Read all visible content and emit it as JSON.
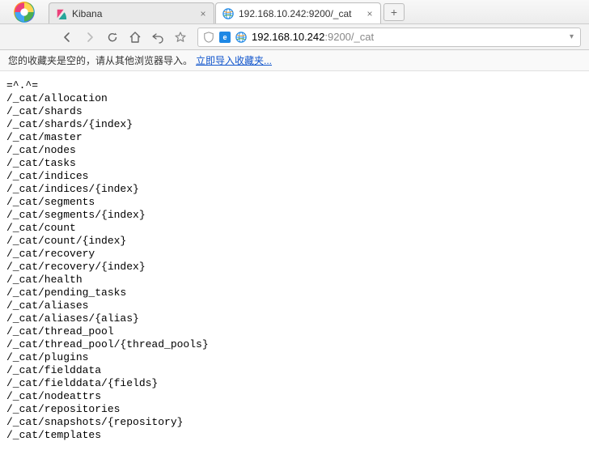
{
  "tabs": [
    {
      "title": "Kibana"
    },
    {
      "title": "192.168.10.242:9200/_cat"
    }
  ],
  "address": {
    "host": "192.168.10.242",
    "port_path": ":9200/_cat"
  },
  "bookmarks_bar": {
    "empty_msg": "您的收藏夹是空的，请从其他浏览器导入。",
    "import_link": "立即导入收藏夹..."
  },
  "body_lines": [
    "=^.^=",
    "/_cat/allocation",
    "/_cat/shards",
    "/_cat/shards/{index}",
    "/_cat/master",
    "/_cat/nodes",
    "/_cat/tasks",
    "/_cat/indices",
    "/_cat/indices/{index}",
    "/_cat/segments",
    "/_cat/segments/{index}",
    "/_cat/count",
    "/_cat/count/{index}",
    "/_cat/recovery",
    "/_cat/recovery/{index}",
    "/_cat/health",
    "/_cat/pending_tasks",
    "/_cat/aliases",
    "/_cat/aliases/{alias}",
    "/_cat/thread_pool",
    "/_cat/thread_pool/{thread_pools}",
    "/_cat/plugins",
    "/_cat/fielddata",
    "/_cat/fielddata/{fields}",
    "/_cat/nodeattrs",
    "/_cat/repositories",
    "/_cat/snapshots/{repository}",
    "/_cat/templates"
  ]
}
